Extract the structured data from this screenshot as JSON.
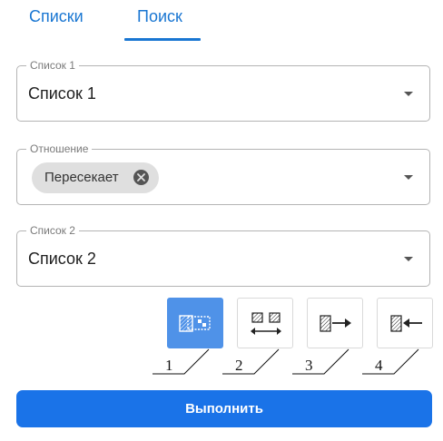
{
  "tabs": {
    "lists_label": "Списки",
    "search_label": "Поиск",
    "active": "search"
  },
  "list1": {
    "label": "Список 1",
    "value": "Список 1"
  },
  "relation": {
    "label": "Отношение",
    "chip_label": "Пересекает"
  },
  "list2": {
    "label": "Список 2",
    "value": "Список 2"
  },
  "operations": {
    "buttons": [
      {
        "icon": "intersect-icon",
        "number": "1",
        "active": true
      },
      {
        "icon": "extent-icon",
        "number": "2",
        "active": false
      },
      {
        "icon": "right-arrow-icon",
        "number": "3",
        "active": false
      },
      {
        "icon": "left-arrow-icon",
        "number": "4",
        "active": false
      }
    ]
  },
  "run_button": {
    "label": "Выполнить"
  },
  "colors": {
    "accent": "#1a73e8",
    "tab_text": "#1976d2",
    "active_op": "#4f92e8",
    "chip_bg": "#dfdfdf",
    "border": "#b4b4b4"
  }
}
